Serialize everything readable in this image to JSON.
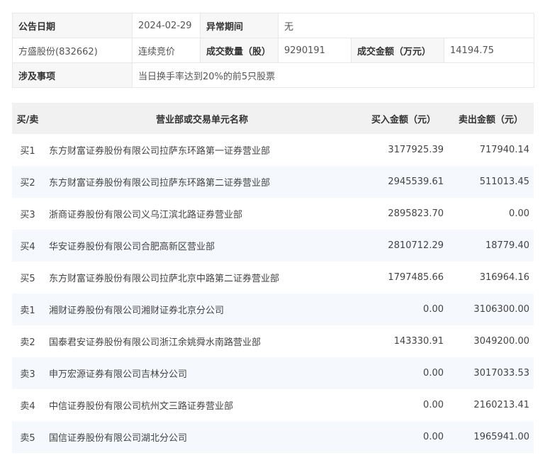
{
  "info": {
    "date_label": "公告日期",
    "date_value": "2024-02-29",
    "abnormal_label": "异常期间",
    "abnormal_value": "无",
    "stock": "方盛股份(832662)",
    "trade_mode": "连续竞价",
    "volume_label": "成交数量（股）",
    "volume_value": "9290191",
    "amount_label": "成交金额（万元）",
    "amount_value": "14194.75",
    "matter_label": "涉及事项",
    "matter_value": "当日换手率达到20%的前5只股票"
  },
  "trades": {
    "headers": [
      "买/卖",
      "营业部或交易单元名称",
      "买入金额（元）",
      "卖出金额（元）"
    ],
    "rows": [
      {
        "side": "买1",
        "name": "东方财富证券股份有限公司拉萨东环路第一证券营业部",
        "buy": "3177925.39",
        "sell": "717940.14"
      },
      {
        "side": "买2",
        "name": "东方财富证券股份有限公司拉萨东环路第二证券营业部",
        "buy": "2945539.61",
        "sell": "511013.45"
      },
      {
        "side": "买3",
        "name": "浙商证券股份有限公司义乌江滨北路证券营业部",
        "buy": "2895823.70",
        "sell": "0.00"
      },
      {
        "side": "买4",
        "name": "华安证券股份有限公司合肥高新区营业部",
        "buy": "2810712.29",
        "sell": "18779.40"
      },
      {
        "side": "买5",
        "name": "东方财富证券股份有限公司拉萨北京中路第二证券营业部",
        "buy": "1797485.66",
        "sell": "316964.16"
      },
      {
        "side": "卖1",
        "name": "湘财证券股份有限公司湘财证券北京分公司",
        "buy": "0.00",
        "sell": "3106300.00"
      },
      {
        "side": "卖2",
        "name": "国泰君安证券股份有限公司浙江余姚舜水南路营业部",
        "buy": "143330.91",
        "sell": "3049200.00"
      },
      {
        "side": "卖3",
        "name": "申万宏源证券有限公司吉林分公司",
        "buy": "0.00",
        "sell": "3017033.53"
      },
      {
        "side": "卖4",
        "name": "中信证券股份有限公司杭州文三路证券营业部",
        "buy": "0.00",
        "sell": "2160213.41"
      },
      {
        "side": "卖5",
        "name": "国信证券股份有限公司湖北分公司",
        "buy": "0.00",
        "sell": "1965941.00"
      }
    ]
  }
}
